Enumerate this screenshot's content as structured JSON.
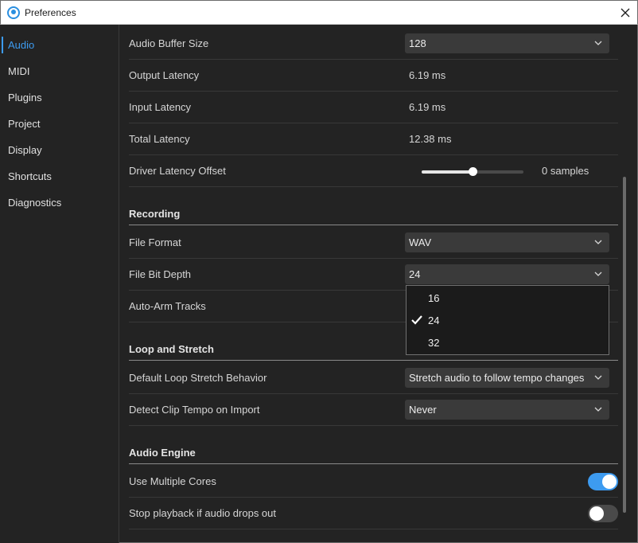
{
  "window": {
    "title": "Preferences"
  },
  "sidebar": {
    "items": [
      {
        "label": "Audio",
        "active": true
      },
      {
        "label": "MIDI"
      },
      {
        "label": "Plugins"
      },
      {
        "label": "Project"
      },
      {
        "label": "Display"
      },
      {
        "label": "Shortcuts"
      },
      {
        "label": "Diagnostics"
      }
    ]
  },
  "audio": {
    "buffer_size": {
      "label": "Audio Buffer Size",
      "value": "128"
    },
    "output_latency": {
      "label": "Output Latency",
      "value": "6.19 ms"
    },
    "input_latency": {
      "label": "Input Latency",
      "value": "6.19 ms"
    },
    "total_latency": {
      "label": "Total Latency",
      "value": "12.38 ms"
    },
    "driver_offset": {
      "label": "Driver Latency Offset",
      "value": "0 samples",
      "slider_fraction": 0.5
    }
  },
  "recording": {
    "header": "Recording",
    "file_format": {
      "label": "File Format",
      "value": "WAV"
    },
    "bit_depth": {
      "label": "File Bit Depth",
      "value": "24",
      "options": [
        "16",
        "24",
        "32"
      ],
      "selected": "24"
    },
    "auto_arm": {
      "label": "Auto-Arm Tracks"
    }
  },
  "loop": {
    "header": "Loop and Stretch",
    "default_behavior": {
      "label": "Default Loop Stretch Behavior",
      "value": "Stretch audio to follow tempo changes"
    },
    "detect_tempo": {
      "label": "Detect Clip Tempo on Import",
      "value": "Never"
    }
  },
  "engine": {
    "header": "Audio Engine",
    "multiple_cores": {
      "label": "Use Multiple Cores",
      "enabled": true
    },
    "stop_on_dropout": {
      "label": "Stop playback if audio drops out",
      "enabled": false
    }
  },
  "icons": {
    "app": "app-logo-icon",
    "close": "close-icon",
    "chevron": "chevron-down-icon",
    "check": "checkmark-icon"
  },
  "colors": {
    "accent": "#3d9bf0",
    "background": "#232323",
    "control": "#3a3a3a"
  }
}
